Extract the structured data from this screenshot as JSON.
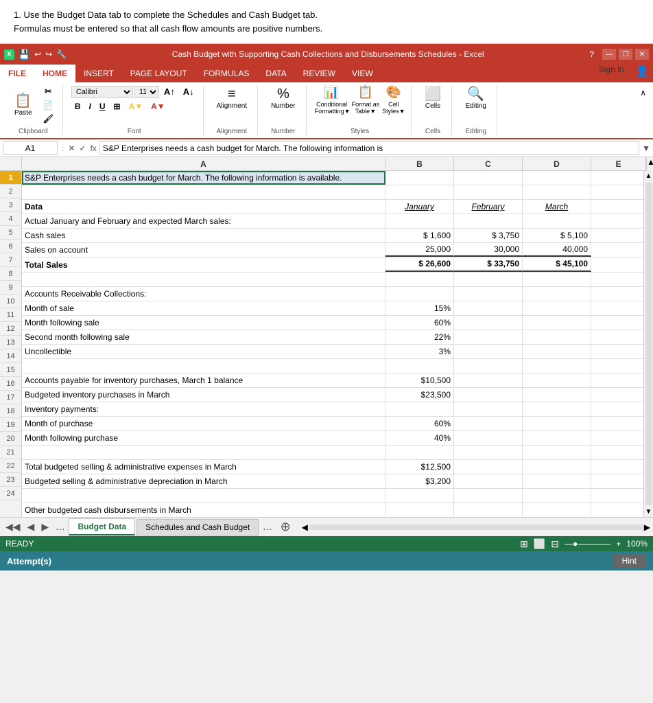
{
  "instruction": {
    "line1": "1.  Use the Budget Data tab to complete the Schedules and Cash Budget tab.",
    "line2": "     Formulas must be entered so that all cash flow amounts are positive numbers."
  },
  "titlebar": {
    "appIcon": "X",
    "title": "Cash Budget with Supporting Cash Collections and Disbursements Schedules - Excel",
    "helpBtn": "?",
    "minimizeBtn": "—",
    "restoreBtn": "❐",
    "closeBtn": "✕"
  },
  "ribbon": {
    "tabs": [
      "FILE",
      "HOME",
      "INSERT",
      "PAGE LAYOUT",
      "FORMULAS",
      "DATA",
      "REVIEW",
      "VIEW"
    ],
    "activeTab": "HOME",
    "signIn": "Sign In",
    "groups": {
      "clipboard": "Clipboard",
      "font": "Font",
      "alignment": "Alignment",
      "number": "Number",
      "styles": "Styles",
      "cells": "Cells",
      "editing": "Editing"
    },
    "buttons": {
      "paste": "Paste",
      "conditionalFormatting": "Conditional\nFormatting",
      "formatAsTable": "Format as\nTable",
      "cellStyles": "Cell\nStyles",
      "alignment": "Alignment",
      "number": "Number",
      "cells": "Cells",
      "editing": "Editing"
    },
    "fontName": "Calibri",
    "fontSize": "11"
  },
  "formulaBar": {
    "cellRef": "A1",
    "formula": "S&P Enterprises needs a cash budget for March. The following information is"
  },
  "columns": {
    "A": "A",
    "B": "B",
    "C": "C",
    "D": "D",
    "E": "E"
  },
  "rows": [
    {
      "num": 1,
      "cells": {
        "A": "S&P Enterprises needs a cash budget for March. The following information is available.",
        "B": "",
        "C": "",
        "D": "",
        "E": ""
      },
      "active": true
    },
    {
      "num": 2,
      "cells": {
        "A": "",
        "B": "",
        "C": "",
        "D": "",
        "E": ""
      }
    },
    {
      "num": 3,
      "cells": {
        "A": "Data",
        "B": "January",
        "C": "February",
        "D": "March",
        "E": ""
      },
      "bold_a": true,
      "italic_bcd": true,
      "underline_bcd": true
    },
    {
      "num": 4,
      "cells": {
        "A": "Actual January and February and expected March sales:",
        "B": "",
        "C": "",
        "D": "",
        "E": ""
      }
    },
    {
      "num": 5,
      "cells": {
        "A": "Cash sales",
        "B": "$    1,600",
        "C": "$    3,750",
        "D": "$    5,100",
        "E": ""
      }
    },
    {
      "num": 6,
      "cells": {
        "A": "Sales on account",
        "B": "25,000",
        "C": "30,000",
        "D": "40,000",
        "E": ""
      },
      "underline_bcd": true
    },
    {
      "num": 7,
      "cells": {
        "A": "Total Sales",
        "B": "$  26,600",
        "C": "$  33,750",
        "D": "$  45,100",
        "E": ""
      },
      "bold_a": true,
      "double_underline_bcd": true
    },
    {
      "num": 8,
      "cells": {
        "A": "",
        "B": "",
        "C": "",
        "D": "",
        "E": ""
      }
    },
    {
      "num": 9,
      "cells": {
        "A": "Accounts Receivable Collections:",
        "B": "",
        "C": "",
        "D": "",
        "E": ""
      }
    },
    {
      "num": 10,
      "cells": {
        "A": "     Month of sale",
        "B": "15%",
        "C": "",
        "D": "",
        "E": ""
      }
    },
    {
      "num": 11,
      "cells": {
        "A": "     Month following sale",
        "B": "60%",
        "C": "",
        "D": "",
        "E": ""
      }
    },
    {
      "num": 12,
      "cells": {
        "A": "     Second month following sale",
        "B": "22%",
        "C": "",
        "D": "",
        "E": ""
      }
    },
    {
      "num": 13,
      "cells": {
        "A": "     Uncollectible",
        "B": "3%",
        "C": "",
        "D": "",
        "E": ""
      }
    },
    {
      "num": 14,
      "cells": {
        "A": "",
        "B": "",
        "C": "",
        "D": "",
        "E": ""
      }
    },
    {
      "num": 15,
      "cells": {
        "A": "Accounts payable for inventory purchases, March 1 balance",
        "B": "$10,500",
        "C": "",
        "D": "",
        "E": ""
      }
    },
    {
      "num": 16,
      "cells": {
        "A": "Budgeted inventory purchases in March",
        "B": "$23,500",
        "C": "",
        "D": "",
        "E": ""
      }
    },
    {
      "num": 17,
      "cells": {
        "A": "Inventory payments:",
        "B": "",
        "C": "",
        "D": "",
        "E": ""
      }
    },
    {
      "num": 18,
      "cells": {
        "A": "     Month of purchase",
        "B": "60%",
        "C": "",
        "D": "",
        "E": ""
      }
    },
    {
      "num": 19,
      "cells": {
        "A": "     Month following purchase",
        "B": "40%",
        "C": "",
        "D": "",
        "E": ""
      }
    },
    {
      "num": 20,
      "cells": {
        "A": "",
        "B": "",
        "C": "",
        "D": "",
        "E": ""
      }
    },
    {
      "num": 21,
      "cells": {
        "A": "Total budgeted selling & administrative expenses in March",
        "B": "$12,500",
        "C": "",
        "D": "",
        "E": ""
      }
    },
    {
      "num": 22,
      "cells": {
        "A": "Budgeted selling & administrative depreciation in March",
        "B": "$3,200",
        "C": "",
        "D": "",
        "E": ""
      }
    },
    {
      "num": 23,
      "cells": {
        "A": "",
        "B": "",
        "C": "",
        "D": "",
        "E": ""
      }
    },
    {
      "num": 24,
      "cells": {
        "A": "Other budgeted cash disbursements in March",
        "B": "",
        "C": "",
        "D": "",
        "E": ""
      }
    }
  ],
  "sheetTabs": {
    "tabs": [
      "Budget Data",
      "Schedules and Cash Budget"
    ],
    "activeTab": "Budget Data",
    "dots1": "...",
    "dots2": "...",
    "addIcon": "+"
  },
  "statusBar": {
    "status": "READY",
    "zoom": "100%"
  },
  "attemptBar": {
    "label": "Attempt(s)",
    "hintBtn": "Hint"
  }
}
